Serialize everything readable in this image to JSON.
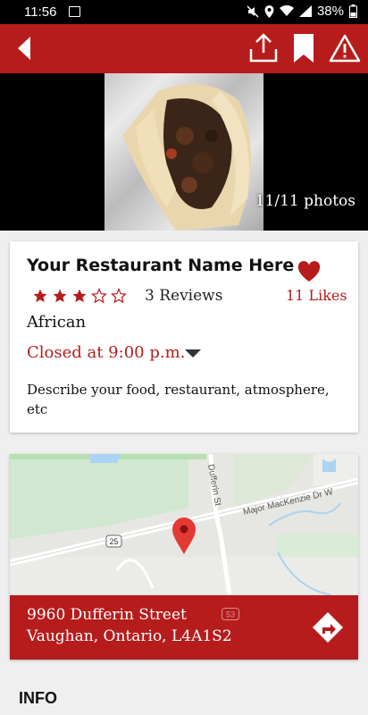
{
  "status_bar": {
    "time": "11:56",
    "battery": "38%"
  },
  "hero": {
    "photo_count": "11/11 photos"
  },
  "restaurant": {
    "name": "Your Restaurant Name Here",
    "rating": 3,
    "rating_max": 5,
    "reviews": "3 Reviews",
    "likes": "11 Likes",
    "cuisine": "African",
    "hours": "Closed at 9:00 p.m.",
    "description": "Describe your food, restaurant, atmosphere, etc"
  },
  "map": {
    "street_labels": [
      "Dufferin St",
      "Major MacKenzie Dr W"
    ],
    "route_shields": [
      "25",
      "53"
    ],
    "address_line1": "9960 Dufferin Street",
    "address_line2": "Vaughan, Ontario, L4A1S2"
  },
  "section": {
    "info_heading": "INFO"
  },
  "colors": {
    "primary": "#b71c1c",
    "status_bar": "#000000"
  }
}
